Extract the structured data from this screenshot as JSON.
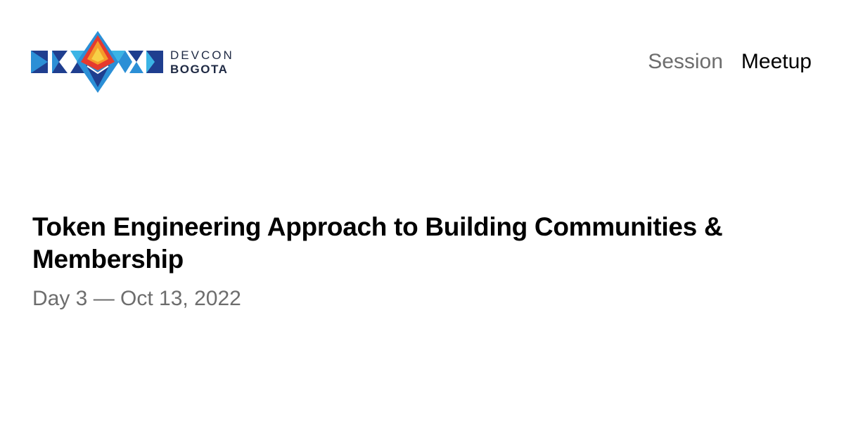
{
  "logo": {
    "line1": "DEVCON",
    "line2": "BOGOTA",
    "colors": {
      "navy": "#1f3e8f",
      "blue": "#2b8fd6",
      "teal": "#3bb4e5",
      "red": "#e53a2e",
      "orange": "#f59b2a",
      "yellow": "#f7d046",
      "text": "#1f2a44"
    }
  },
  "nav": {
    "session": "Session",
    "meetup": "Meetup"
  },
  "event": {
    "title": "Token Engineering Approach to Building Communities & Membership",
    "date_line": "Day 3 — Oct 13, 2022"
  }
}
